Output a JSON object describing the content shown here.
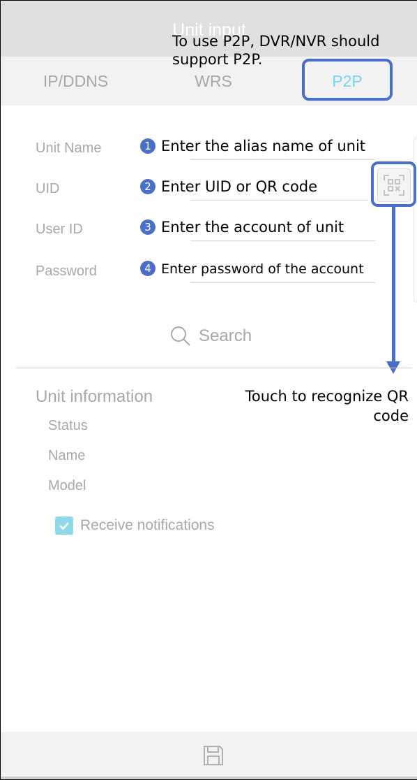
{
  "header": {
    "title": "Unit input"
  },
  "tabs": [
    {
      "label": "IP/DDNS",
      "active": false
    },
    {
      "label": "WRS",
      "active": false
    },
    {
      "label": "P2P",
      "active": true
    }
  ],
  "annotations": {
    "top_note": "To use P2P, DVR/NVR should support P2P.",
    "qr_note": "Touch to recognize QR code",
    "color_highlight": "#4a6fc8"
  },
  "form": {
    "fields": [
      {
        "label": "Unit Name",
        "badge": "1",
        "hint": "Enter the alias name of unit",
        "value": ""
      },
      {
        "label": "UID",
        "badge": "2",
        "hint": "Enter UID or QR code",
        "value": ""
      },
      {
        "label": "User ID",
        "badge": "3",
        "hint": "Enter the account of unit",
        "value": ""
      },
      {
        "label": "Password",
        "badge": "4",
        "hint": "Enter password of the account",
        "value": ""
      }
    ],
    "qr_icon": "qr-scan-icon",
    "search_label": "Search"
  },
  "unit_info": {
    "title": "Unit information",
    "rows": [
      "Status",
      "Name",
      "Model"
    ],
    "notifications": {
      "label": "Receive notifications",
      "checked": true
    }
  },
  "footer": {
    "save_icon": "save-icon"
  },
  "colors": {
    "active_tab": "#76d6f4",
    "checkbox": "#8ed8ea",
    "muted_text": "#a8a8a8"
  }
}
